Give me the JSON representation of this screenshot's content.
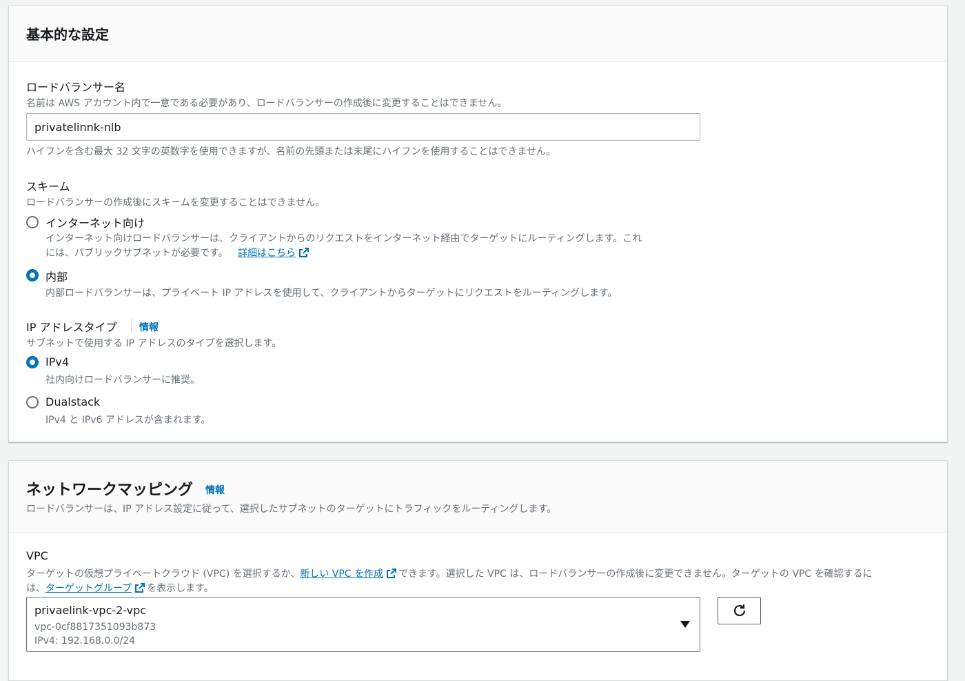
{
  "basic": {
    "title": "基本的な設定",
    "lb_name_label": "ロードバランサー名",
    "lb_name_desc": "名前は AWS アカウント内で一意である必要があり、ロードバランサーの作成後に変更することはできません。",
    "lb_name_value": "privatelinnk-nlb",
    "lb_name_hint": "ハイフンを含む最大 32 文字の英数字を使用できますが、名前の先頭または末尾にハイフンを使用することはできません。",
    "scheme_label": "スキーム",
    "scheme_desc": "ロードバランサーの作成後にスキームを変更することはできません。",
    "scheme_options": [
      {
        "label": "インターネット向け",
        "desc_line1": "インターネット向けロードバランサーは、クライアントからのリクエストをインターネット経由でターゲットにルーティングします。これ",
        "desc_line2": "には、パブリックサブネットが必要です。",
        "link": "詳細はこちら",
        "checked": false
      },
      {
        "label": "内部",
        "desc_line1": "内部ロードバランサーは、プライベート IP アドレスを使用して、クライアントからターゲットにリクエストをルーティングします。",
        "checked": true
      }
    ],
    "ip_label": "IP アドレスタイプ",
    "ip_info": "情報",
    "ip_desc": "サブネットで使用する IP アドレスのタイプを選択します。",
    "ip_options": [
      {
        "label": "IPv4",
        "desc": "社内向けロードバランサーに推奨。",
        "checked": true
      },
      {
        "label": "Dualstack",
        "desc": "IPv4 と IPv6 アドレスが含まれます。",
        "checked": false
      }
    ]
  },
  "network": {
    "title": "ネットワークマッピング",
    "info": "情報",
    "desc": "ロードバランサーは、IP アドレス設定に従って、選択したサブネットのターゲットにトラフィックをルーティングします。",
    "vpc_label": "VPC",
    "vpc_desc_part1": "ターゲットの仮想プライベートクラウド (VPC) を選択するか、",
    "vpc_desc_link1": "新しい VPC を作成",
    "vpc_desc_part2": "できます。選択した VPC は、ロードバランサーの作成後に変更できません。ターゲットの VPC を確認するに",
    "vpc_desc_part3": "は、",
    "vpc_desc_link2": "ターゲットグループ",
    "vpc_desc_part4": "を表示します。",
    "vpc_selected": {
      "name": "privaelink-vpc-2-vpc",
      "id": "vpc-0cf8817351093b873",
      "cidr": "IPv4: 192.168.0.0/24"
    }
  },
  "colors": {
    "accent": "#0073bb",
    "text": "#16191f",
    "muted": "#687078"
  },
  "icons": {
    "external": "external-link-icon",
    "refresh": "refresh-icon",
    "dropdown": "caret-down-icon"
  }
}
